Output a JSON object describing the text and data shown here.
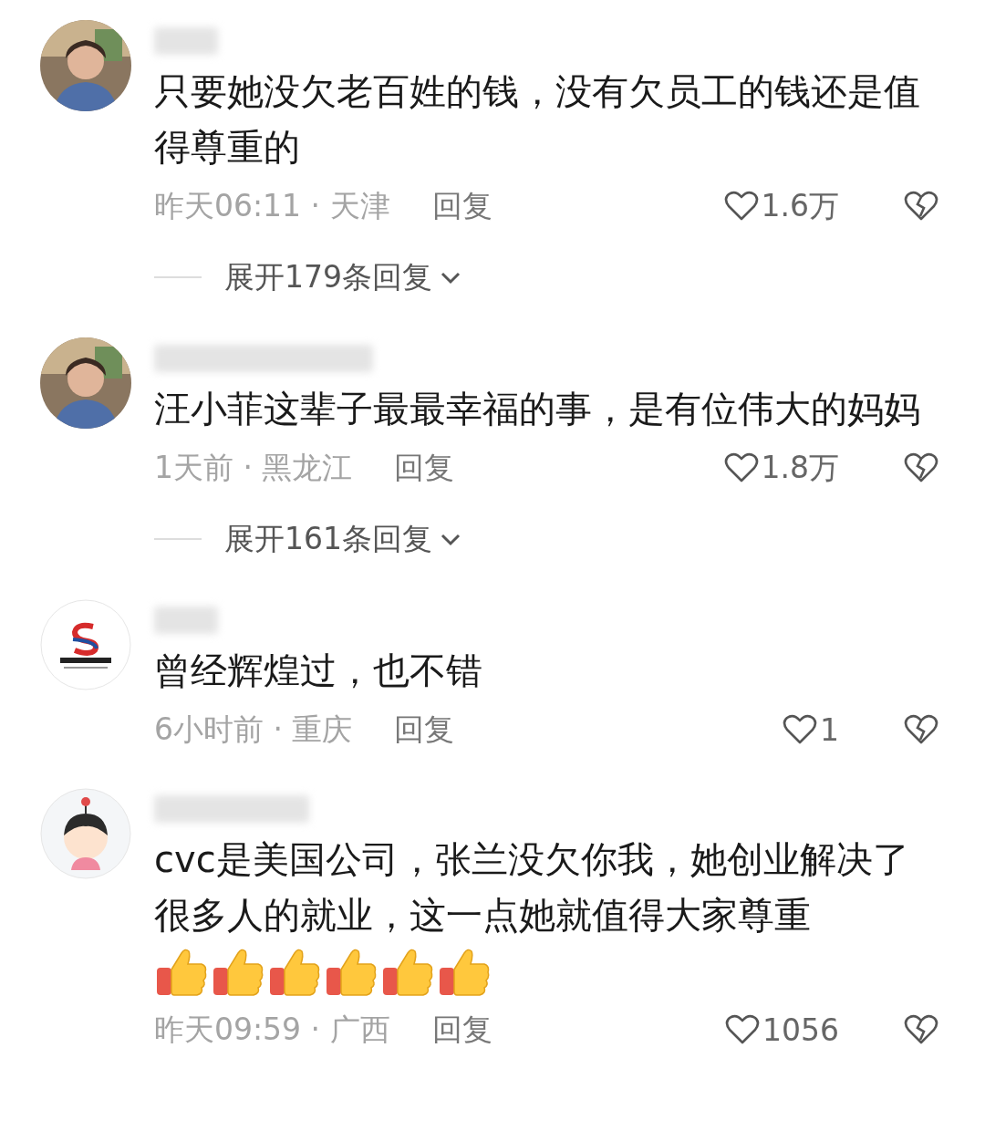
{
  "comments": [
    {
      "text": "只要她没欠老百姓的钱，没有欠员工的钱还是值得尊重的",
      "meta": "昨天06:11 · 天津",
      "reply": "回复",
      "likes": "1.6万",
      "expand": "展开179条回复"
    },
    {
      "text": "汪小菲这辈子最最幸福的事，是有位伟大的妈妈",
      "meta": "1天前 · 黑龙江",
      "reply": "回复",
      "likes": "1.8万",
      "expand": "展开161条回复"
    },
    {
      "avatar": {
        "kind": "logo"
      },
      "text": "曾经辉煌过，也不错",
      "meta": "6小时前 · 重庆",
      "reply": "回复",
      "likes": "1"
    },
    {
      "avatar": {
        "kind": "cartoon"
      },
      "text": "cvc是美国公司，张兰没欠你我，她创业解决了很多人的就业，这一点她就值得大家尊重",
      "emojis": [
        {
          "kind": "thumbs-up"
        },
        {
          "kind": "thumbs-up"
        },
        {
          "kind": "thumbs-up"
        },
        {
          "kind": "thumbs-up"
        },
        {
          "kind": "thumbs-up"
        },
        {
          "kind": "thumbs-up"
        }
      ],
      "meta": "昨天09:59 · 广西",
      "reply": "回复",
      "likes": "1056"
    }
  ]
}
